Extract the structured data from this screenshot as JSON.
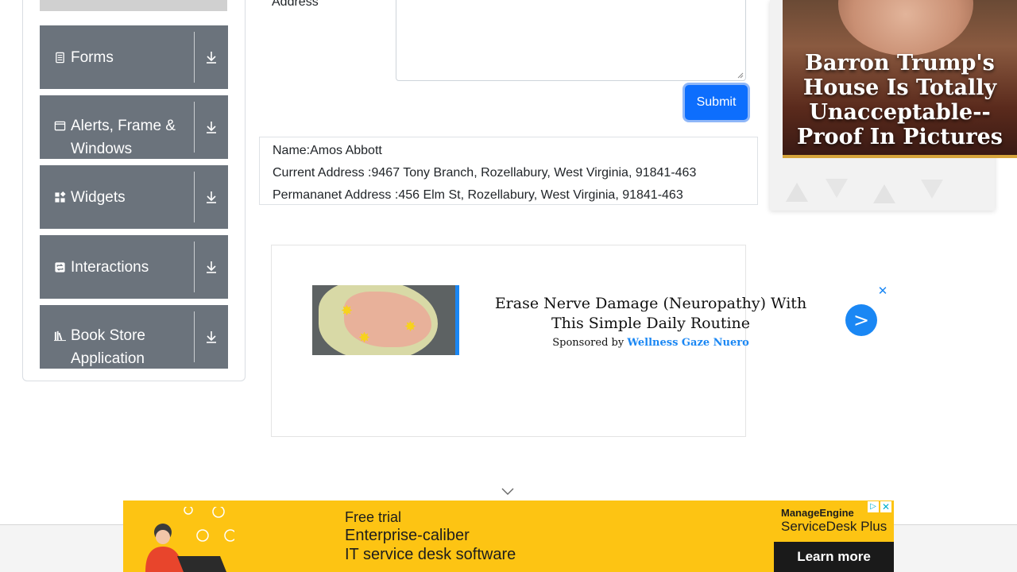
{
  "sidebar": {
    "groups": [
      {
        "label": "Forms",
        "icon": "form-icon"
      },
      {
        "label": "Alerts, Frame & Windows",
        "icon": "window-icon"
      },
      {
        "label": "Widgets",
        "icon": "widgets-icon"
      },
      {
        "label": "Interactions",
        "icon": "interactions-icon"
      },
      {
        "label": "Book Store Application",
        "icon": "books-icon"
      }
    ]
  },
  "form": {
    "address_label": "Address",
    "submit_label": "Submit"
  },
  "output": {
    "name": "Name:Amos Abbott",
    "current_address": "Current Address :9467 Tony Branch, Rozellabury, West Virginia, 91841-463",
    "permanent_address": "Permananet Address :456 Elm St, Rozellabury, West Virginia, 91841-463"
  },
  "ads": {
    "right": {
      "title": "Barron Trump's House Is Totally Unacceptable--Proof In Pictures"
    },
    "middle": {
      "headline": "Erase Nerve Damage (Neuropathy) With This Simple Daily Routine",
      "sponsor_prefix": "Sponsored by",
      "sponsor_name": "Wellness Gaze Nuero",
      "go_symbol": ">",
      "close_symbol": "✕"
    },
    "bottom": {
      "line1": "Free trial",
      "line2": "Enterprise-caliber",
      "line3": "IT service desk software",
      "brand_top": "ManageEngine",
      "brand_bottom": "ServiceDesk Plus",
      "cta": "Learn more",
      "adchoices_symbol": "▷",
      "close_symbol": "✕"
    }
  },
  "colors": {
    "sidebar_group_bg": "#6b737c",
    "submit_bg": "#0d6efd",
    "ad_accent": "#1a87f4",
    "banner_bg": "#fdc413"
  }
}
